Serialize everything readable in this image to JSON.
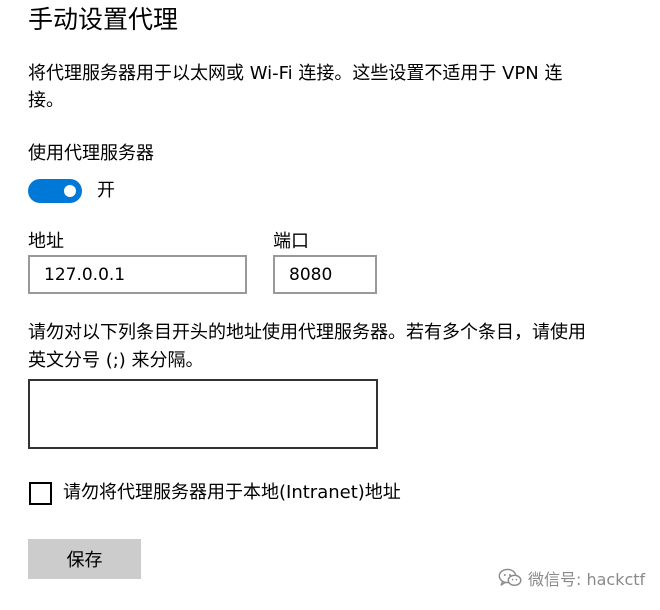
{
  "page": {
    "title": "手动设置代理",
    "description": "将代理服务器用于以太网或 Wi-Fi 连接。这些设置不适用于 VPN 连接。"
  },
  "proxy_toggle": {
    "label": "使用代理服务器",
    "state_label": "开",
    "on": true,
    "accent_color": "#0078d7"
  },
  "address": {
    "label": "地址",
    "value": "127.0.0.1"
  },
  "port": {
    "label": "端口",
    "value": "8080"
  },
  "exceptions": {
    "description": "请勿对以下列条目开头的地址使用代理服务器。若有多个条目，请使用英文分号 (;) 来分隔。",
    "value": ""
  },
  "bypass_local": {
    "label": "请勿将代理服务器用于本地(Intranet)地址",
    "checked": false
  },
  "save_button": {
    "label": "保存"
  },
  "watermark": {
    "icon": "wechat-icon",
    "text": "微信号: hackctf"
  }
}
